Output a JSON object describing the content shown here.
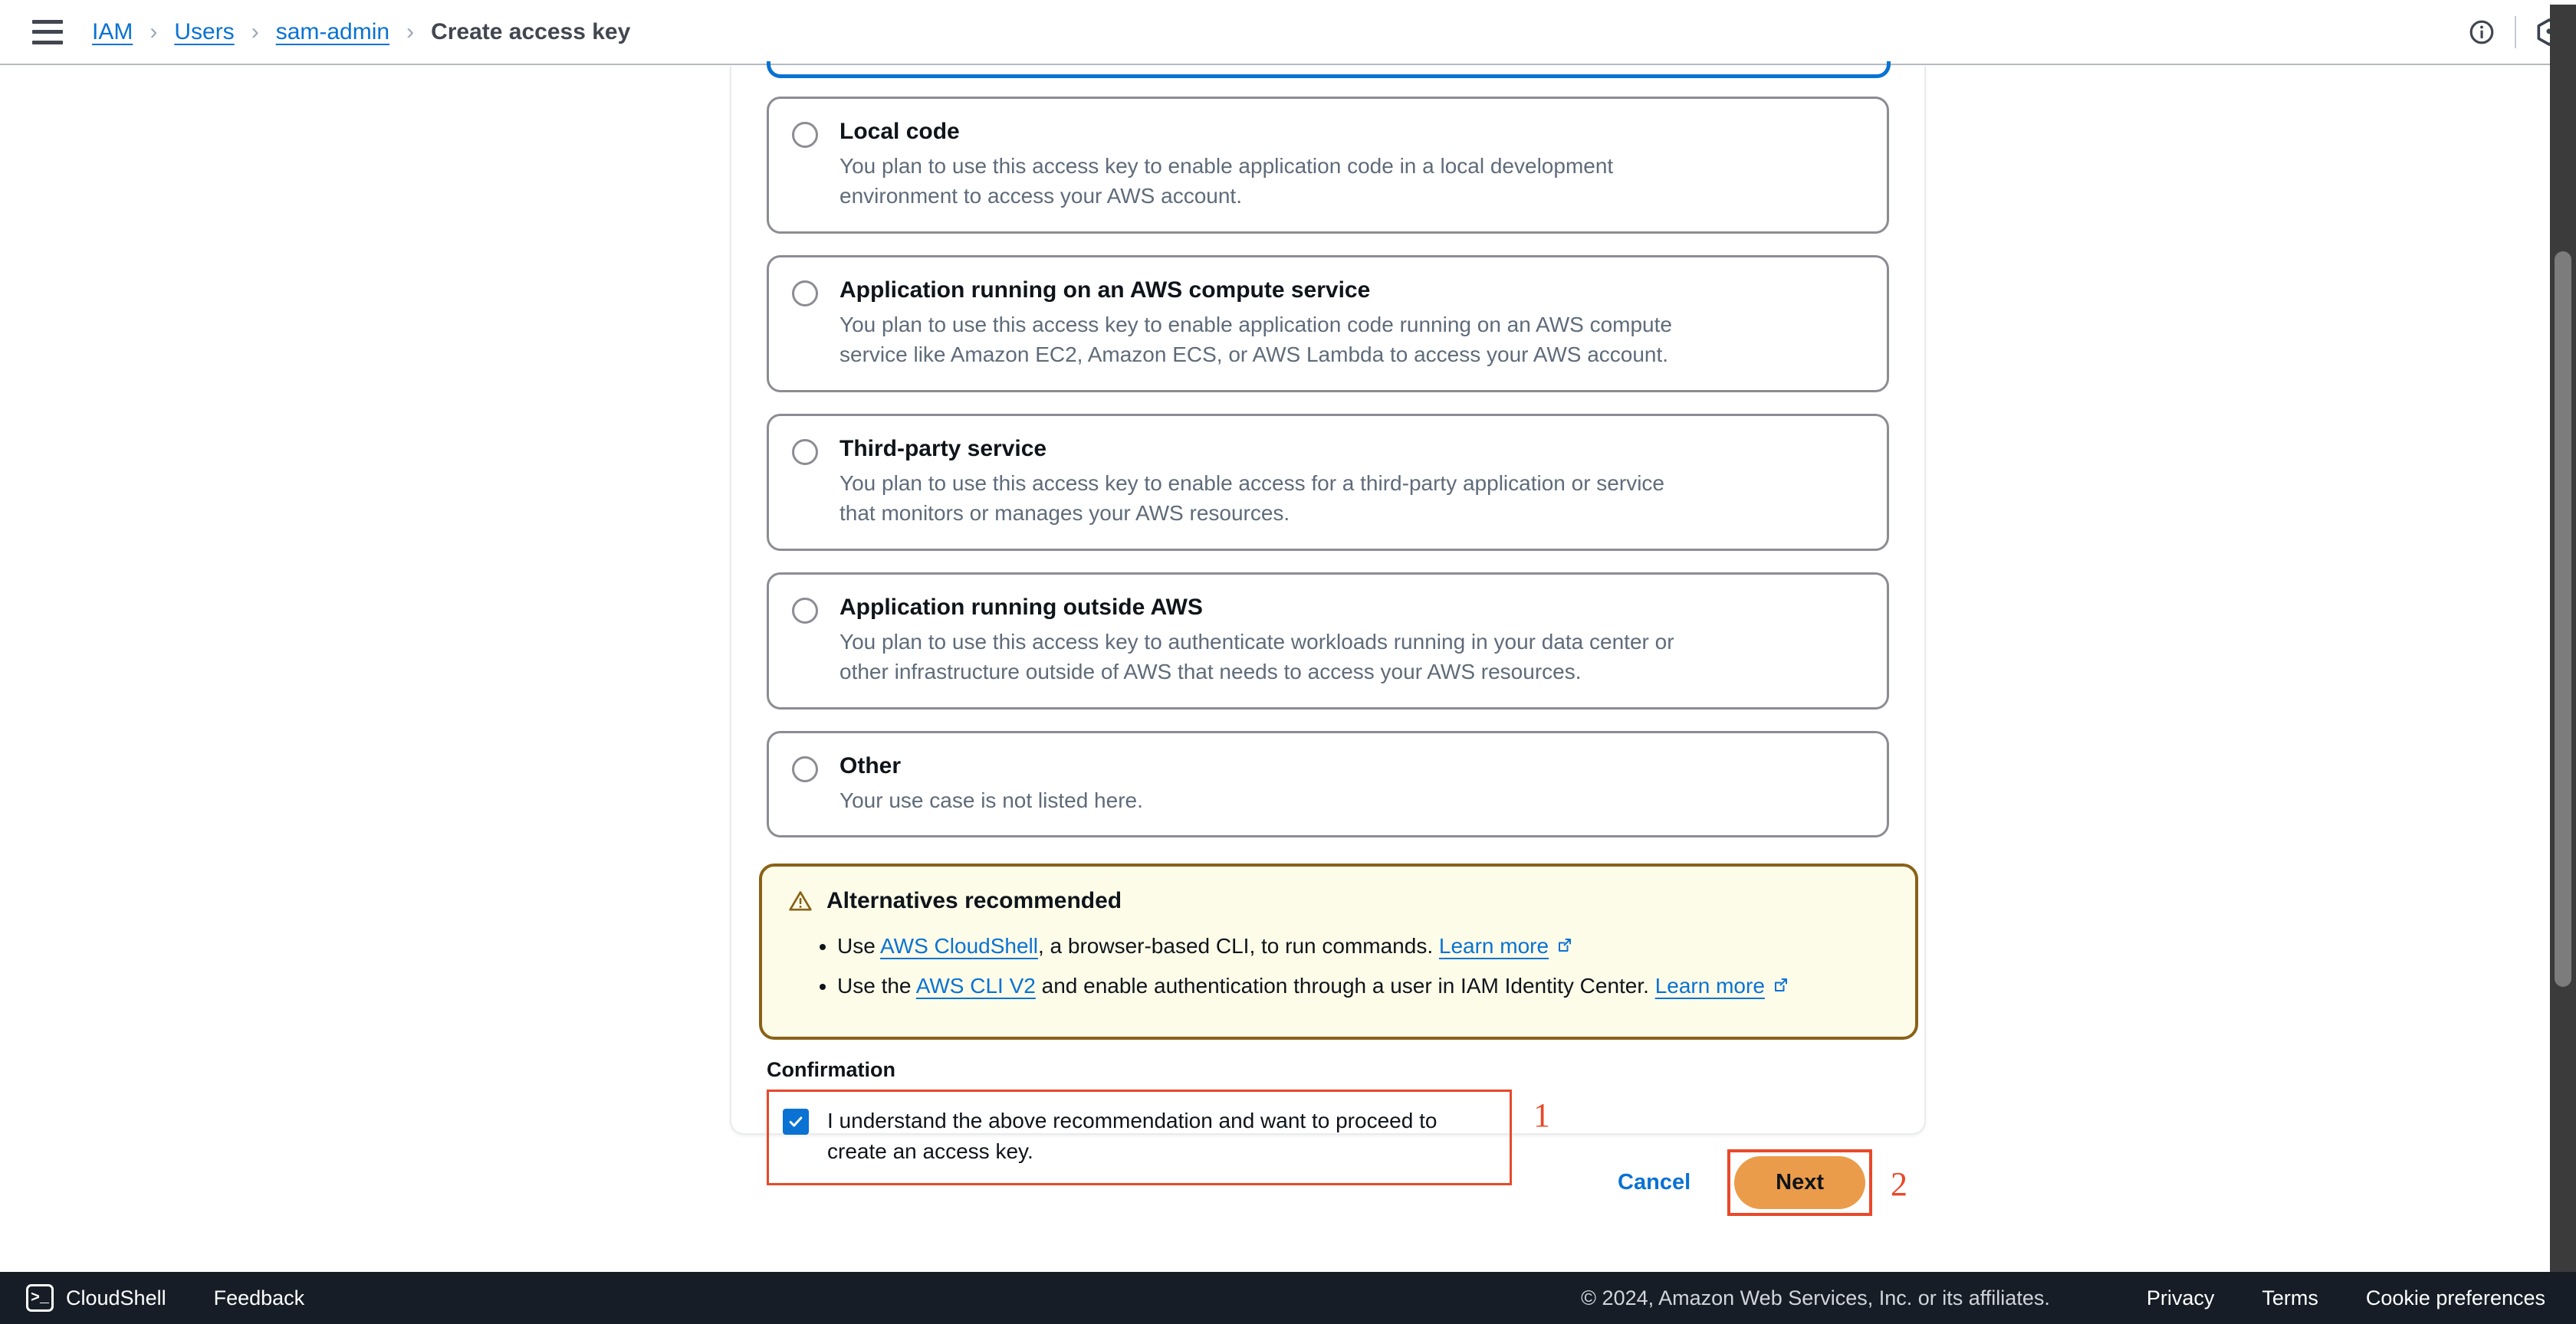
{
  "header": {
    "menu_icon": "hamburger-icon",
    "breadcrumb": [
      {
        "label": "IAM",
        "type": "link"
      },
      {
        "label": "Users",
        "type": "link"
      },
      {
        "label": "sam-admin",
        "type": "link"
      },
      {
        "label": "Create access key",
        "type": "current"
      }
    ],
    "separator": "›",
    "info_icon": "info-circle-icon",
    "settings_icon": "hexagon-settings-icon"
  },
  "main": {
    "options": [
      {
        "title": "Local code",
        "description": "You plan to use this access key to enable application code in a local development environment to access your AWS account.",
        "selected": false
      },
      {
        "title": "Application running on an AWS compute service",
        "description": "You plan to use this access key to enable application code running on an AWS compute service like Amazon EC2, Amazon ECS, or AWS Lambda to access your AWS account.",
        "selected": false
      },
      {
        "title": "Third-party service",
        "description": "You plan to use this access key to enable access for a third-party application or service that monitors or manages your AWS resources.",
        "selected": false
      },
      {
        "title": "Application running outside AWS",
        "description": "You plan to use this access key to authenticate workloads running in your data center or other infrastructure outside of AWS that needs to access your AWS resources.",
        "selected": false
      },
      {
        "title": "Other",
        "description": "Your use case is not listed here.",
        "selected": false
      }
    ],
    "alert": {
      "icon": "warning-triangle-icon",
      "heading": "Alternatives recommended",
      "bullets": [
        {
          "prefix": "Use ",
          "link1": "AWS CloudShell",
          "middle": ", a browser-based CLI, to run commands. ",
          "link2": "Learn more",
          "external_icon": "external-link-icon"
        },
        {
          "prefix": "Use the ",
          "link1": "AWS CLI V2",
          "middle": " and enable authentication through a user in IAM Identity Center. ",
          "link2": "Learn more",
          "external_icon": "external-link-icon"
        }
      ]
    },
    "confirmation": {
      "label": "Confirmation",
      "checkbox_checked": true,
      "checkbox_icon": "checkmark-icon",
      "text": "I understand the above recommendation and want to proceed to create an access key.",
      "annotation": "1"
    }
  },
  "actions": {
    "cancel_label": "Cancel",
    "next_label": "Next",
    "annotation": "2"
  },
  "footer": {
    "cloudshell_icon": "cloudshell-terminal-icon",
    "cloudshell_label": "CloudShell",
    "feedback_label": "Feedback",
    "copyright": "© 2024, Amazon Web Services, Inc. or its affiliates.",
    "privacy_label": "Privacy",
    "terms_label": "Terms",
    "cookie_label": "Cookie preferences"
  },
  "colors": {
    "accent_blue": "#0972d3",
    "next_orange": "#eb9c4a",
    "annotation_red": "#e8492a",
    "alert_border": "#8a6116",
    "alert_bg": "#fdfce9",
    "footer_bg": "#161d26"
  }
}
